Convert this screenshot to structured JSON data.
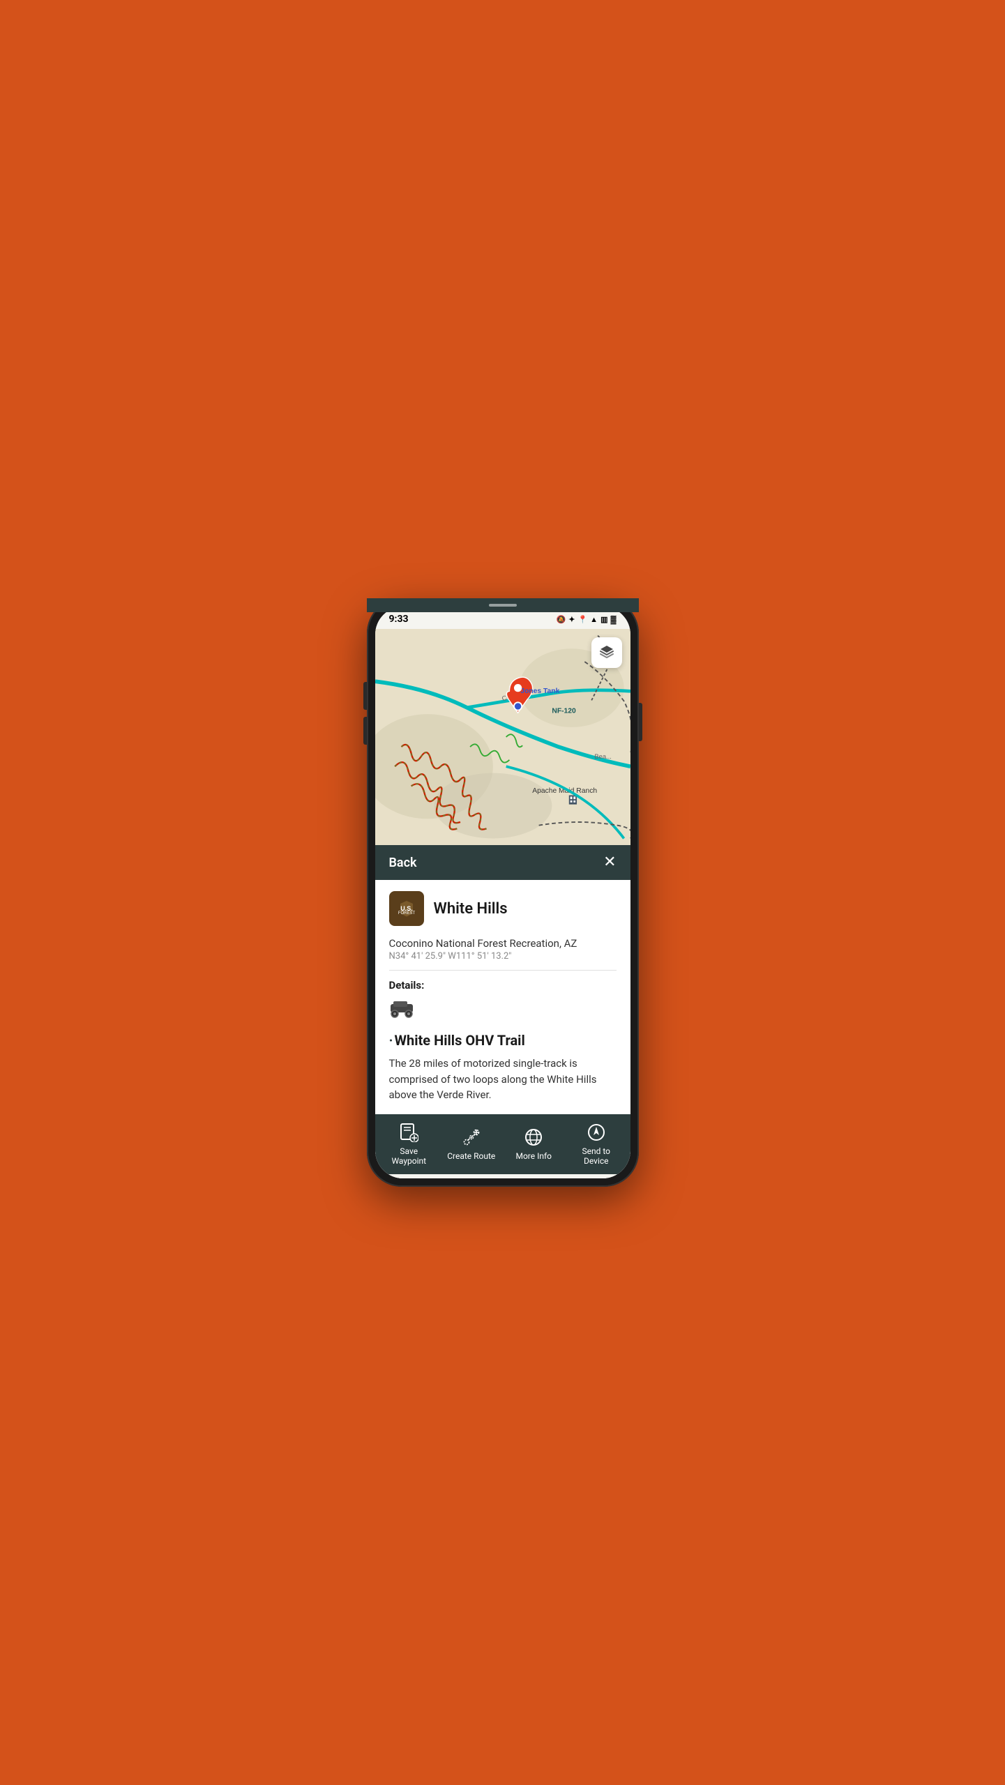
{
  "status_bar": {
    "time": "9:33",
    "icons": [
      "🔕",
      "🔵",
      "📍",
      "📶",
      "📶",
      "🔋"
    ]
  },
  "map": {
    "location_label": "Jones Tank",
    "road_label": "NF-120",
    "street_label": "Cornville",
    "ranch_label": "Apache Maid Ranch"
  },
  "sheet": {
    "back_label": "Back",
    "close_label": "✕",
    "poi_name": "White Hills",
    "poi_location": "Coconino National Forest Recreation, AZ",
    "poi_coords": "N34° 41' 25.9\" W111° 51' 13.2\"",
    "details_label": "Details:",
    "trail_title": "White Hills OHV Trail",
    "trail_description": "The 28 miles of motorized single-track is comprised of two loops along the White Hills above the Verde River."
  },
  "toolbar": {
    "save_waypoint_label": "Save\nWaypoint",
    "create_route_label": "Create Route",
    "more_info_label": "More Info",
    "send_to_device_label": "Send to\nDevice"
  },
  "android_nav": {
    "square_label": "□",
    "circle_label": "○",
    "back_label": "◁"
  },
  "colors": {
    "bg_orange": "#d4521a",
    "phone_dark": "#2d3e3e",
    "map_bg": "#e8e0c8",
    "trail_red": "#cc2200",
    "trail_green": "#33aa33",
    "road_teal": "#00bbbb"
  }
}
